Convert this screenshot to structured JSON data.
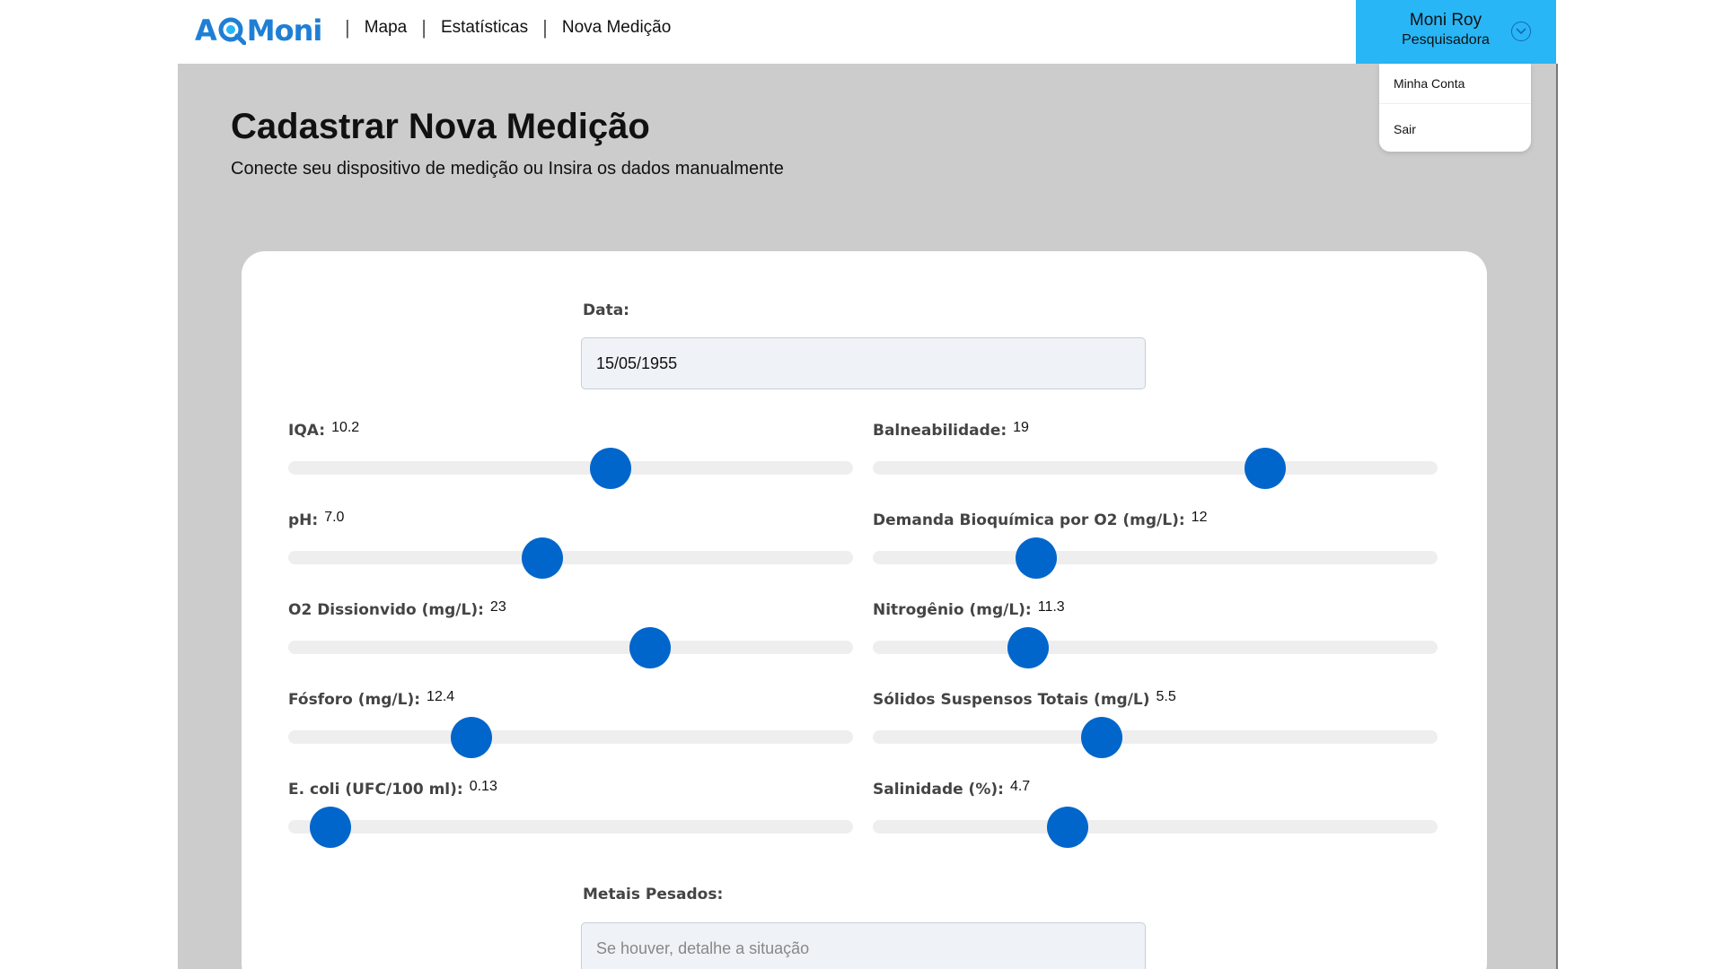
{
  "header": {
    "logo_text": [
      "A",
      "Moni"
    ],
    "nav": [
      {
        "label": "Mapa"
      },
      {
        "label": "Estatísticas"
      },
      {
        "label": "Nova Medição"
      }
    ],
    "separator": "|",
    "user": {
      "name": "Moni Roy",
      "role": "Pesquisadora"
    },
    "dropdown": [
      "Minha Conta",
      "Sair"
    ],
    "accent_color": "#29b6f6"
  },
  "page": {
    "title": "Cadastrar Nova Medição",
    "subtitle": "Conecte seu dispositivo de medição ou Insira os dados manualmente"
  },
  "form": {
    "date_label": "Data:",
    "date_value": "15/05/1955",
    "sliders": [
      {
        "label": "IQA:",
        "value": "10.2",
        "fraction": 0.57
      },
      {
        "label": "Balneabilidade:",
        "value": "19",
        "fraction": 0.695
      },
      {
        "label": "pH:",
        "value": "7.0",
        "fraction": 0.45
      },
      {
        "label": "Demanda Bioquímica por O2 (mg/L):",
        "value": "12",
        "fraction": 0.29
      },
      {
        "label": "O2 Dissionvido (mg/L):",
        "value": "23",
        "fraction": 0.64
      },
      {
        "label": "Nitrogênio (mg/L):",
        "value": "11.3",
        "fraction": 0.275
      },
      {
        "label": "Fósforo (mg/L):",
        "value": "12.4",
        "fraction": 0.325
      },
      {
        "label": "Sólidos Suspensos Totais (mg/L)",
        "value": "5.5",
        "fraction": 0.405
      },
      {
        "label": "E. coli (UFC/100 ml):",
        "value": "0.13",
        "fraction": 0.075
      },
      {
        "label": "Salinidade (%):",
        "value": "4.7",
        "fraction": 0.345
      }
    ],
    "metals_label": "Metais Pesados:",
    "metals_placeholder": "Se houver, detalhe a situação",
    "slider_color": "#0066cc"
  }
}
